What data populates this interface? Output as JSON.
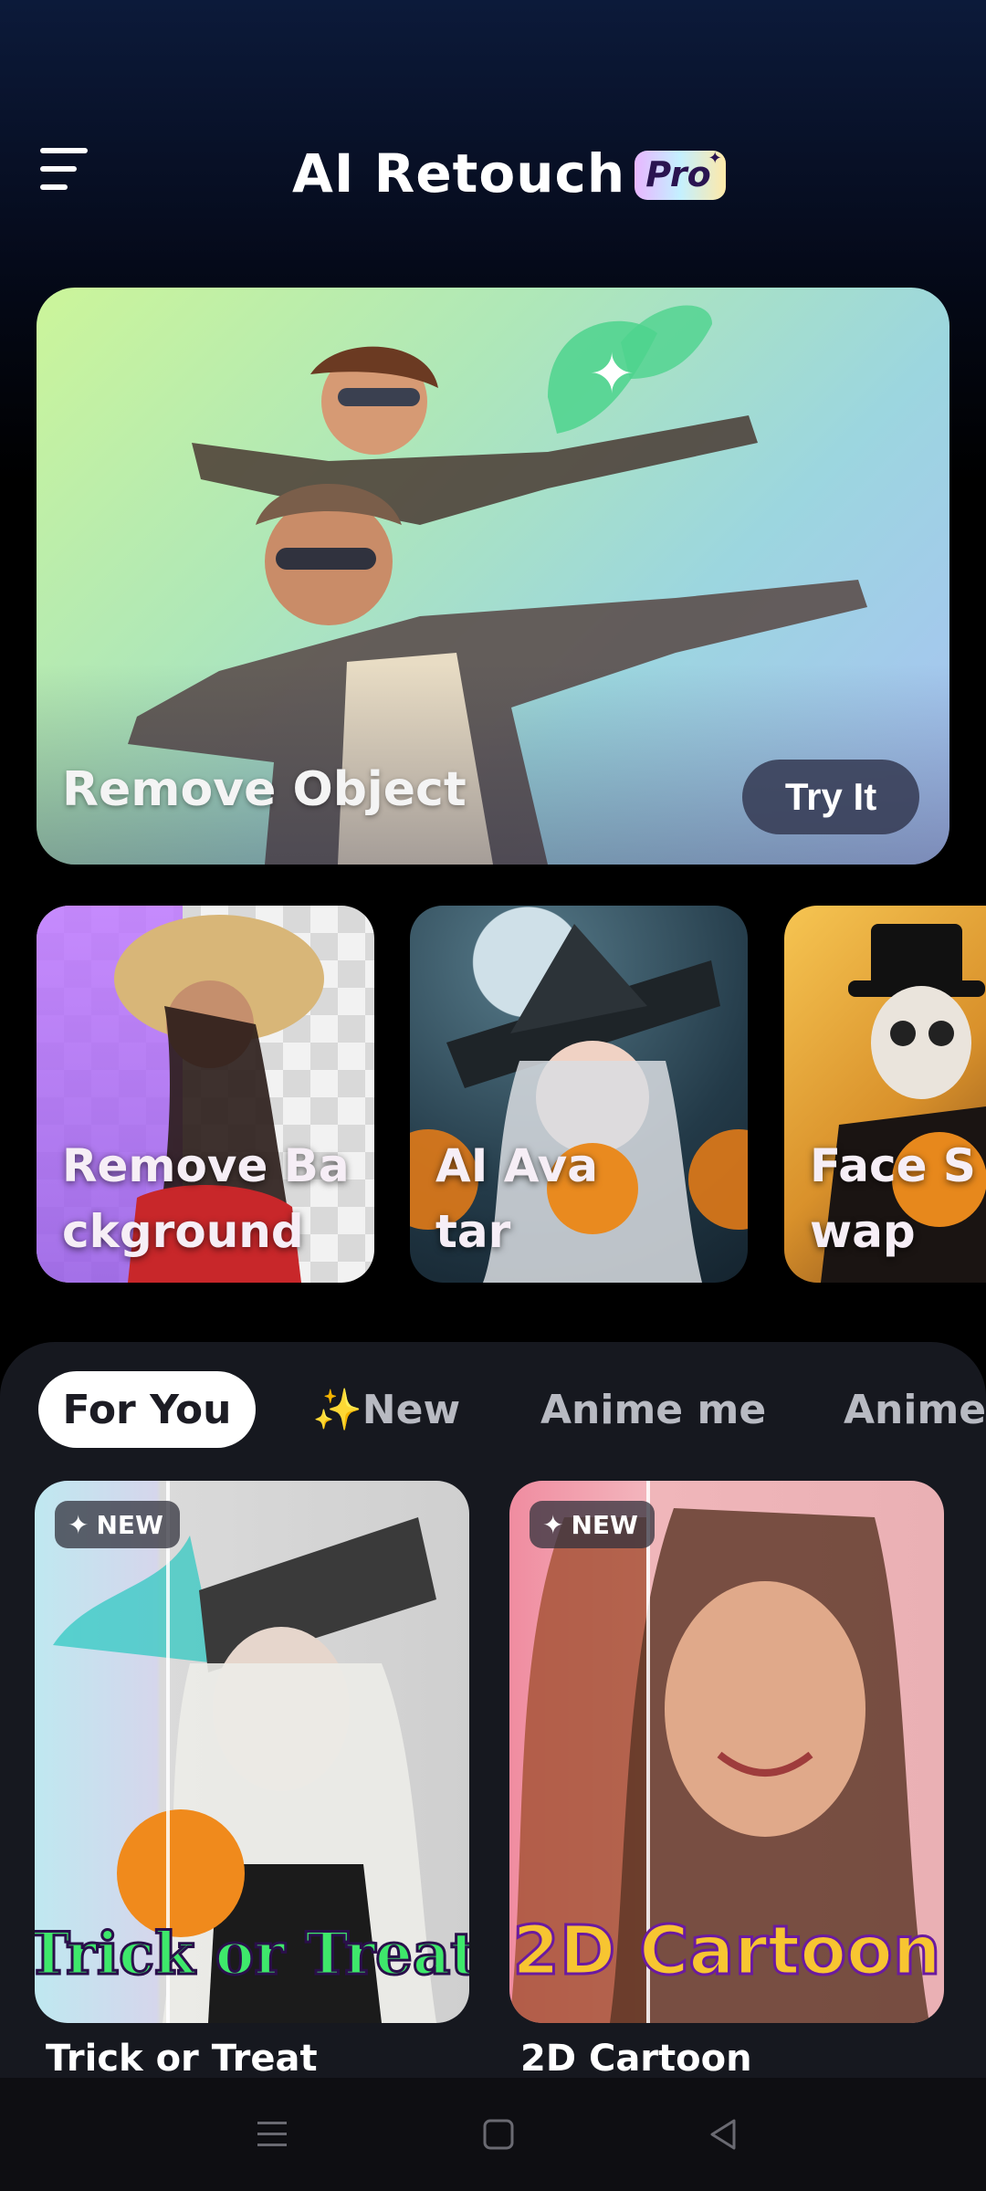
{
  "app": {
    "name": "AI Retouch",
    "badge": "Pro",
    "menu_icon": "hamburger-menu-icon"
  },
  "hero": {
    "title": "Remove Object",
    "button": "Try It"
  },
  "features": [
    {
      "label": "Remove Background"
    },
    {
      "label": "AI Avatar"
    },
    {
      "label": "Face Swap"
    }
  ],
  "tabs": [
    {
      "label": "For You",
      "active": true
    },
    {
      "label": "✨New",
      "active": false
    },
    {
      "label": "Anime me",
      "active": false
    },
    {
      "label": "Anime",
      "active": false
    }
  ],
  "tiles": [
    {
      "badge": "NEW",
      "art_text": "Trick or Treat",
      "title": "Trick or Treat"
    },
    {
      "badge": "NEW",
      "art_text": "2D Cartoon",
      "title": "2D Cartoon"
    }
  ],
  "navbar": {
    "icons": [
      "recents-icon",
      "home-icon",
      "back-icon"
    ]
  },
  "colors": {
    "background": "#000000",
    "panel": "#16181f",
    "accent_active_tab": "#ffffff"
  }
}
